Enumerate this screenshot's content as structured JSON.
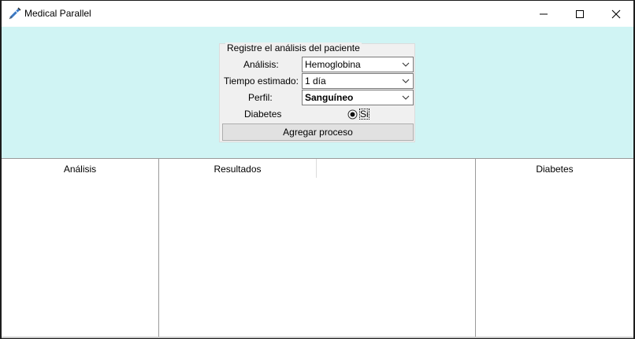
{
  "window": {
    "title": "Medical Parallel",
    "controls": {
      "minimize_icon": "minimize-icon",
      "maximize_icon": "maximize-icon",
      "close_icon": "close-icon"
    }
  },
  "form": {
    "legend": "Registre el análisis del paciente",
    "analisis": {
      "label": "Análisis:",
      "value": "Hemoglobina"
    },
    "tiempo": {
      "label": "Tiempo estimado:",
      "value": "1 día"
    },
    "perfil": {
      "label": "Perfil:",
      "value": "Sanguíneo"
    },
    "diabetes": {
      "label": "Diabetes",
      "option_label": "Si",
      "selected": true
    },
    "add_button": "Agregar proceso"
  },
  "table": {
    "columns": [
      "Análisis",
      "Resultados",
      "",
      "Diabetes"
    ],
    "rows": []
  },
  "colors": {
    "form_background": "#d0f4f4",
    "group_background": "#f0f0f0",
    "button_background": "#e1e1e1"
  }
}
